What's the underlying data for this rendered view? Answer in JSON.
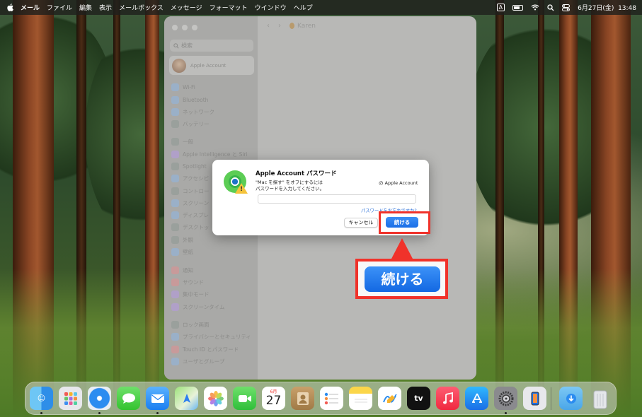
{
  "menubar": {
    "app_name": "メール",
    "items": [
      "ファイル",
      "編集",
      "表示",
      "メールボックス",
      "メッセージ",
      "フォーマット",
      "ウインドウ",
      "ヘルプ"
    ],
    "input_mode": "A",
    "clock": "6月27日(金)  13:48"
  },
  "settings": {
    "search_placeholder": "検索",
    "account_label": "Apple Account",
    "back_symbol": "‹",
    "forward_symbol": "›",
    "pane_title": "Karen",
    "sidebar_items": [
      {
        "label": "Wi-Fi",
        "icon": "wifi-icon"
      },
      {
        "label": "Bluetooth",
        "icon": "bluetooth-icon"
      },
      {
        "label": "ネットワーク",
        "icon": "network-icon"
      },
      {
        "label": "バッテリー",
        "icon": "battery-icon"
      },
      {
        "label": "一般",
        "icon": "gear-icon"
      },
      {
        "label": "Apple Intelligence と Siri",
        "icon": "siri-icon"
      },
      {
        "label": "Spotlight",
        "icon": "spotlight-icon"
      },
      {
        "label": "アクセシビ",
        "icon": "accessibility-icon"
      },
      {
        "label": "コントロー",
        "icon": "control-center-icon"
      },
      {
        "label": "スクリーン",
        "icon": "screensaver-icon"
      },
      {
        "label": "ディスプレ",
        "icon": "display-icon"
      },
      {
        "label": "デスクトッ",
        "icon": "desktop-icon"
      },
      {
        "label": "外観",
        "icon": "appearance-icon"
      },
      {
        "label": "壁紙",
        "icon": "wallpaper-icon"
      },
      {
        "label": "通知",
        "icon": "notifications-icon"
      },
      {
        "label": "サウンド",
        "icon": "sound-icon"
      },
      {
        "label": "集中モード",
        "icon": "focus-icon"
      },
      {
        "label": "スクリーンタイム",
        "icon": "screen-time-icon"
      },
      {
        "label": "ロック画面",
        "icon": "lock-screen-icon"
      },
      {
        "label": "プライバシーとセキュリティ",
        "icon": "privacy-icon"
      },
      {
        "label": "Touch ID とパスワード",
        "icon": "touch-id-icon"
      },
      {
        "label": "ユーザとグループ",
        "icon": "users-icon"
      }
    ]
  },
  "dialog": {
    "title": "Apple Account パスワード",
    "message_line1": "\"Mac を探す\" をオフにするには",
    "message_line2": "パスワードを入力してください。",
    "account_suffix": "の Apple Account",
    "password_value": "",
    "forgot_link": "パスワードをお忘れですか?",
    "cancel_label": "キャンセル",
    "continue_label": "続ける"
  },
  "callout": {
    "label": "続ける",
    "highlight_color": "#f0322a"
  },
  "dock": {
    "apps": [
      "finder-icon",
      "launchpad-icon",
      "safari-icon",
      "messages-icon",
      "mail-icon",
      "maps-icon",
      "photos-icon",
      "facetime-icon",
      "calendar-icon",
      "contacts-icon",
      "reminders-icon",
      "notes-icon",
      "freeform-icon",
      "apple-tv-icon",
      "music-icon",
      "app-store-icon",
      "system-settings-icon",
      "iphone-mirroring-icon",
      "downloads-icon",
      "trash-icon"
    ],
    "calendar_month": "6月",
    "calendar_day": "27",
    "tv_label": "tv"
  }
}
